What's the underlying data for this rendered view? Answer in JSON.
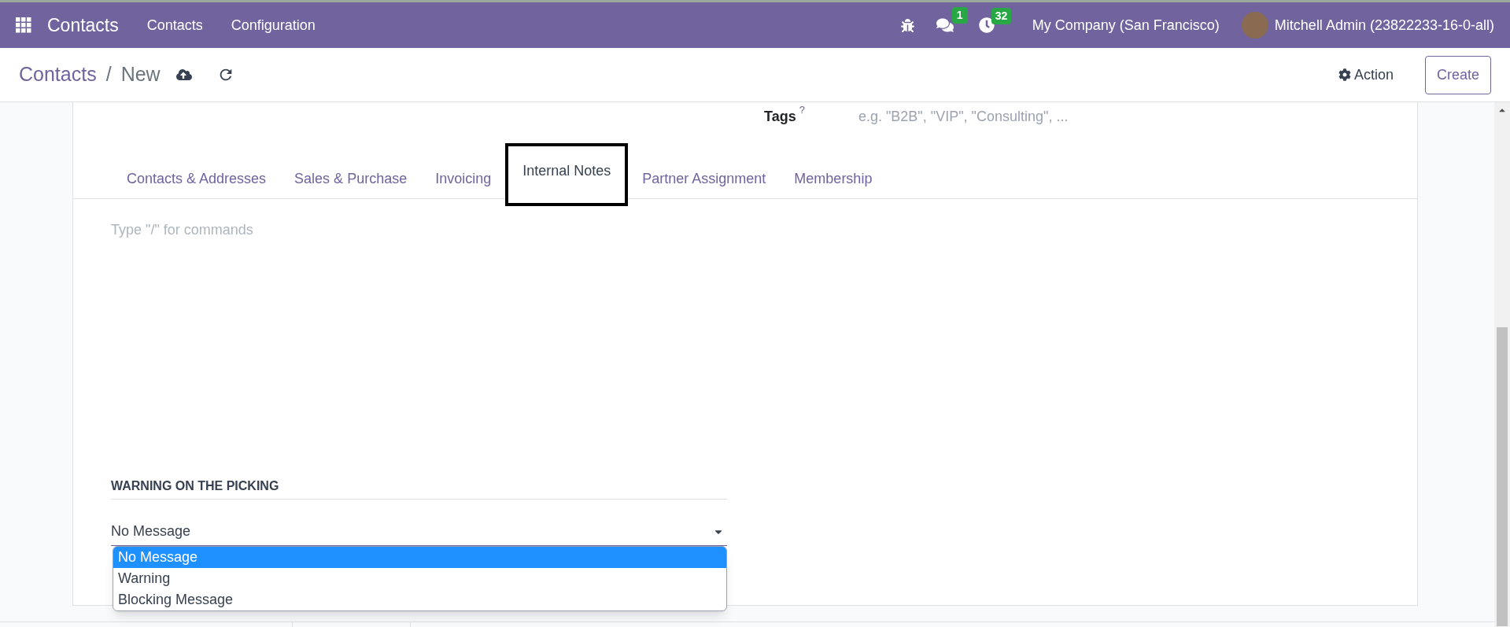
{
  "navbar": {
    "app": "Contacts",
    "menu": [
      "Contacts",
      "Configuration"
    ],
    "messages_count": "1",
    "activities_count": "32",
    "company": "My Company (San Francisco)",
    "user": "Mitchell Admin (23822233-16-0-all)"
  },
  "breadcrumb": {
    "parent": "Contacts",
    "separator": "/",
    "current": "New"
  },
  "actions": {
    "action": "Action",
    "create": "Create"
  },
  "tags": {
    "label": "Tags",
    "help": "?",
    "placeholder": "e.g. \"B2B\", \"VIP\", \"Consulting\", ..."
  },
  "tabs": [
    {
      "label": "Contacts & Addresses",
      "selected": false
    },
    {
      "label": "Sales & Purchase",
      "selected": false
    },
    {
      "label": "Invoicing",
      "selected": false
    },
    {
      "label": "Internal Notes",
      "selected": true
    },
    {
      "label": "Partner Assignment",
      "selected": false
    },
    {
      "label": "Membership",
      "selected": false
    }
  ],
  "notes": {
    "placeholder": "Type \"/\" for commands"
  },
  "warning": {
    "title": "WARNING ON THE PICKING",
    "value": "No Message",
    "options": [
      {
        "label": "No Message",
        "selected": true
      },
      {
        "label": "Warning",
        "selected": false
      },
      {
        "label": "Blocking Message",
        "selected": false
      }
    ]
  }
}
